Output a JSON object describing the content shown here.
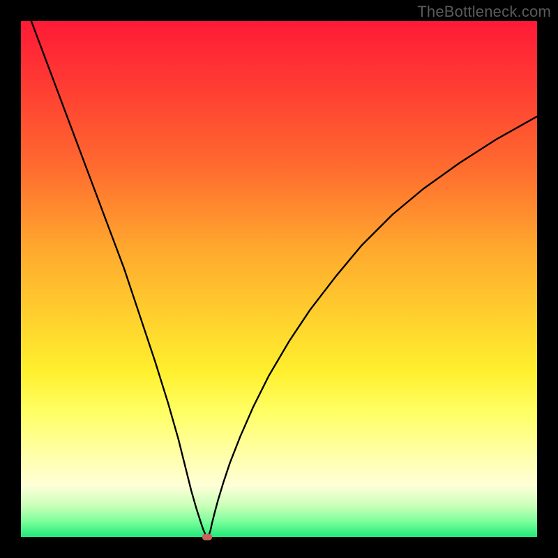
{
  "watermark": "TheBottleneck.com",
  "chart_data": {
    "type": "line",
    "title": "",
    "xlabel": "",
    "ylabel": "",
    "xlim": [
      0,
      100
    ],
    "ylim": [
      0,
      100
    ],
    "series": [
      {
        "name": "curve",
        "x": [
          2,
          5,
          8,
          11,
          14,
          17,
          20,
          23,
          26,
          28.5,
          30.5,
          32,
          33,
          34,
          34.8,
          35.3,
          35.7,
          36,
          36.2,
          36.4,
          36.7,
          37,
          37.5,
          38.2,
          39.2,
          40.5,
          42.5,
          45,
          48,
          52,
          56,
          61,
          66,
          72,
          78,
          85,
          92,
          100
        ],
        "y": [
          100,
          92,
          84,
          76,
          68,
          60,
          52,
          43,
          34,
          26,
          19,
          13,
          9,
          5.5,
          3,
          1.5,
          0.6,
          0,
          0,
          0.4,
          1.2,
          2.6,
          4.6,
          7.2,
          10.5,
          14.4,
          19.5,
          25.2,
          31.2,
          38,
          44,
          50.5,
          56.5,
          62.5,
          67.5,
          72.5,
          77,
          81.5
        ]
      }
    ],
    "marker": {
      "x": 36.1,
      "y": 0
    },
    "grid": false,
    "legend": false
  }
}
